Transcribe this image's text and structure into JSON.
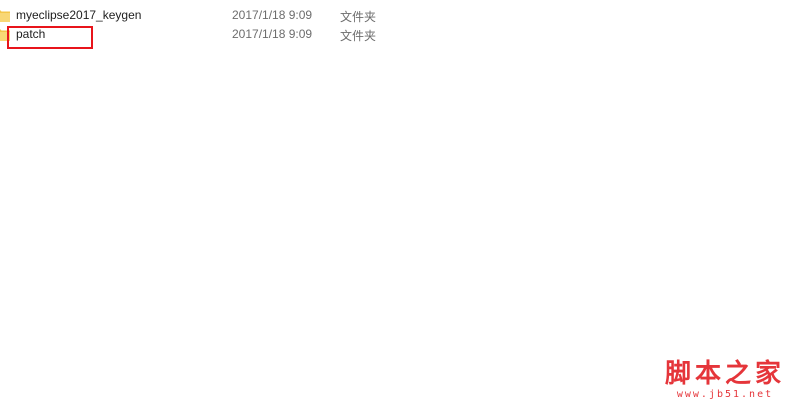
{
  "files": [
    {
      "name": "myeclipse2017_keygen",
      "date": "2017/1/18 9:09",
      "type": "文件夹",
      "icon": "folder-icon"
    },
    {
      "name": "patch",
      "date": "2017/1/18 9:09",
      "type": "文件夹",
      "icon": "folder-icon"
    }
  ],
  "annotation": {
    "color": "#e8141b",
    "target": "patch"
  },
  "watermark": {
    "title": "脚本之家",
    "url": "www.jb51.net",
    "color": "#e5353a"
  }
}
